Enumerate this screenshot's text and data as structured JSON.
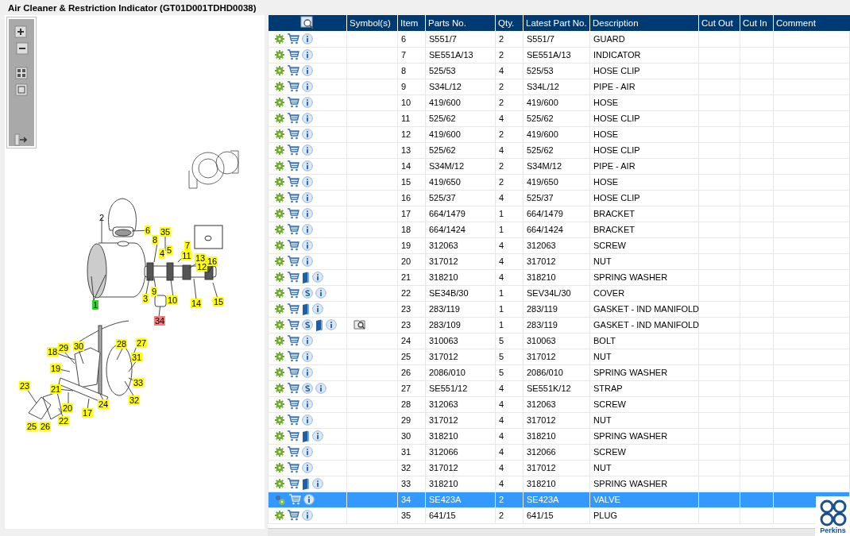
{
  "title": "Air Cleaner & Restriction Indicator (GT01D001TDHD0038)",
  "callouts": [
    {
      "label": "1",
      "color": "#22dd22"
    },
    {
      "label": "2"
    },
    {
      "label": "3",
      "color": "#ffff00"
    },
    {
      "label": "4",
      "color": "#ffff00"
    },
    {
      "label": "5",
      "color": "#ffff00"
    },
    {
      "label": "6",
      "color": "#ffff00"
    },
    {
      "label": "7",
      "color": "#ffff00"
    },
    {
      "label": "8",
      "color": "#ffff00"
    },
    {
      "label": "9",
      "color": "#ffff00"
    },
    {
      "label": "10",
      "color": "#ffff00"
    },
    {
      "label": "11",
      "color": "#ffff00"
    },
    {
      "label": "12",
      "color": "#ffff00"
    },
    {
      "label": "13",
      "color": "#ffff00"
    },
    {
      "label": "14",
      "color": "#ffff00"
    },
    {
      "label": "15",
      "color": "#ffff00"
    },
    {
      "label": "16",
      "color": "#ffff00"
    },
    {
      "label": "17",
      "color": "#ffff00"
    },
    {
      "label": "18",
      "color": "#ffff00"
    },
    {
      "label": "19",
      "color": "#ffff00"
    },
    {
      "label": "20",
      "color": "#ffff00"
    },
    {
      "label": "21",
      "color": "#ffff00"
    },
    {
      "label": "22",
      "color": "#ffff00"
    },
    {
      "label": "23",
      "color": "#ffff00"
    },
    {
      "label": "24",
      "color": "#ffff00"
    },
    {
      "label": "25",
      "color": "#ffff00"
    },
    {
      "label": "26",
      "color": "#ffff00"
    },
    {
      "label": "28",
      "color": "#ffff00"
    },
    {
      "label": "27",
      "color": "#ffff00"
    },
    {
      "label": "29",
      "color": "#ffff00"
    },
    {
      "label": "30",
      "color": "#ffff00"
    },
    {
      "label": "31",
      "color": "#ffff00"
    },
    {
      "label": "33",
      "color": "#ffff00"
    },
    {
      "label": "32",
      "color": "#ffff00"
    },
    {
      "label": "34",
      "color": "#f08080"
    },
    {
      "label": "35",
      "color": "#ffff00"
    }
  ],
  "table": {
    "columns": [
      "Symbol(s)",
      "Item",
      "Parts No.",
      "Qty.",
      "Latest Part No.",
      "Description",
      "Cut Out",
      "Cut In",
      "Comment"
    ],
    "rows": [
      {
        "item": "6",
        "part_no": "S551/7",
        "qty": "2",
        "latest_part_no": "S551/7",
        "description": "GUARD",
        "book": false,
        "s_badge": false,
        "selected": false
      },
      {
        "item": "7",
        "part_no": "SE551A/13",
        "qty": "2",
        "latest_part_no": "SE551A/13",
        "description": "INDICATOR",
        "book": false,
        "s_badge": false,
        "selected": false
      },
      {
        "item": "8",
        "part_no": "525/53",
        "qty": "4",
        "latest_part_no": "525/53",
        "description": "HOSE CLIP",
        "book": false,
        "s_badge": false,
        "selected": false
      },
      {
        "item": "9",
        "part_no": "S34L/12",
        "qty": "2",
        "latest_part_no": "S34L/12",
        "description": "PIPE - AIR",
        "book": false,
        "s_badge": false,
        "selected": false
      },
      {
        "item": "10",
        "part_no": "419/600",
        "qty": "2",
        "latest_part_no": "419/600",
        "description": "HOSE",
        "book": false,
        "s_badge": false,
        "selected": false
      },
      {
        "item": "11",
        "part_no": "525/62",
        "qty": "4",
        "latest_part_no": "525/62",
        "description": "HOSE CLIP",
        "book": false,
        "s_badge": false,
        "selected": false
      },
      {
        "item": "12",
        "part_no": "419/600",
        "qty": "2",
        "latest_part_no": "419/600",
        "description": "HOSE",
        "book": false,
        "s_badge": false,
        "selected": false
      },
      {
        "item": "13",
        "part_no": "525/62",
        "qty": "4",
        "latest_part_no": "525/62",
        "description": "HOSE CLIP",
        "book": false,
        "s_badge": false,
        "selected": false
      },
      {
        "item": "14",
        "part_no": "S34M/12",
        "qty": "2",
        "latest_part_no": "S34M/12",
        "description": "PIPE - AIR",
        "book": false,
        "s_badge": false,
        "selected": false
      },
      {
        "item": "15",
        "part_no": "419/650",
        "qty": "2",
        "latest_part_no": "419/650",
        "description": "HOSE",
        "book": false,
        "s_badge": false,
        "selected": false
      },
      {
        "item": "16",
        "part_no": "525/37",
        "qty": "4",
        "latest_part_no": "525/37",
        "description": "HOSE CLIP",
        "book": false,
        "s_badge": false,
        "selected": false
      },
      {
        "item": "17",
        "part_no": "664/1479",
        "qty": "1",
        "latest_part_no": "664/1479",
        "description": "BRACKET",
        "book": false,
        "s_badge": false,
        "selected": false
      },
      {
        "item": "18",
        "part_no": "664/1424",
        "qty": "1",
        "latest_part_no": "664/1424",
        "description": "BRACKET",
        "book": false,
        "s_badge": false,
        "selected": false
      },
      {
        "item": "19",
        "part_no": "312063",
        "qty": "4",
        "latest_part_no": "312063",
        "description": "SCREW",
        "book": false,
        "s_badge": false,
        "selected": false
      },
      {
        "item": "20",
        "part_no": "317012",
        "qty": "4",
        "latest_part_no": "317012",
        "description": "NUT",
        "book": false,
        "s_badge": false,
        "selected": false
      },
      {
        "item": "21",
        "part_no": "318210",
        "qty": "4",
        "latest_part_no": "318210",
        "description": "SPRING WASHER",
        "book": true,
        "s_badge": false,
        "selected": false
      },
      {
        "item": "22",
        "part_no": "SE34B/30",
        "qty": "1",
        "latest_part_no": "SEV34L/30",
        "description": "COVER",
        "book": false,
        "s_badge": true,
        "selected": false
      },
      {
        "item": "23",
        "part_no": "283/119",
        "qty": "1",
        "latest_part_no": "283/119",
        "description": "GASKET - IND MANIFOLD",
        "book": true,
        "s_badge": false,
        "selected": false
      },
      {
        "item": "23",
        "part_no": "283/109",
        "qty": "1",
        "latest_part_no": "283/119",
        "description": "GASKET - IND MANIFOLD",
        "book": true,
        "s_badge": true,
        "book_magnifier": true,
        "selected": false
      },
      {
        "item": "24",
        "part_no": "310063",
        "qty": "5",
        "latest_part_no": "310063",
        "description": "BOLT",
        "book": false,
        "s_badge": false,
        "selected": false
      },
      {
        "item": "25",
        "part_no": "317012",
        "qty": "5",
        "latest_part_no": "317012",
        "description": "NUT",
        "book": false,
        "s_badge": false,
        "selected": false
      },
      {
        "item": "26",
        "part_no": "2086/010",
        "qty": "5",
        "latest_part_no": "2086/010",
        "description": "SPRING WASHER",
        "book": false,
        "s_badge": false,
        "selected": false
      },
      {
        "item": "27",
        "part_no": "SE551/12",
        "qty": "4",
        "latest_part_no": "SE551K/12",
        "description": "STRAP",
        "book": false,
        "s_badge": true,
        "selected": false
      },
      {
        "item": "28",
        "part_no": "312063",
        "qty": "4",
        "latest_part_no": "312063",
        "description": "SCREW",
        "book": false,
        "s_badge": false,
        "selected": false
      },
      {
        "item": "29",
        "part_no": "317012",
        "qty": "4",
        "latest_part_no": "317012",
        "description": "NUT",
        "book": false,
        "s_badge": false,
        "selected": false
      },
      {
        "item": "30",
        "part_no": "318210",
        "qty": "4",
        "latest_part_no": "318210",
        "description": "SPRING WASHER",
        "book": true,
        "s_badge": false,
        "selected": false
      },
      {
        "item": "31",
        "part_no": "312066",
        "qty": "4",
        "latest_part_no": "312066",
        "description": "SCREW",
        "book": false,
        "s_badge": false,
        "selected": false
      },
      {
        "item": "32",
        "part_no": "317012",
        "qty": "4",
        "latest_part_no": "317012",
        "description": "NUT",
        "book": false,
        "s_badge": false,
        "selected": false
      },
      {
        "item": "33",
        "part_no": "318210",
        "qty": "4",
        "latest_part_no": "318210",
        "description": "SPRING WASHER",
        "book": true,
        "s_badge": false,
        "selected": false
      },
      {
        "item": "34",
        "part_no": "SE423A",
        "qty": "2",
        "latest_part_no": "SE423A",
        "description": "VALVE",
        "book": false,
        "s_badge": false,
        "selected": true
      },
      {
        "item": "35",
        "part_no": "641/15",
        "qty": "2",
        "latest_part_no": "641/15",
        "description": "PLUG",
        "book": false,
        "s_badge": false,
        "selected": false
      }
    ]
  },
  "logo": {
    "text": "Perkins"
  }
}
